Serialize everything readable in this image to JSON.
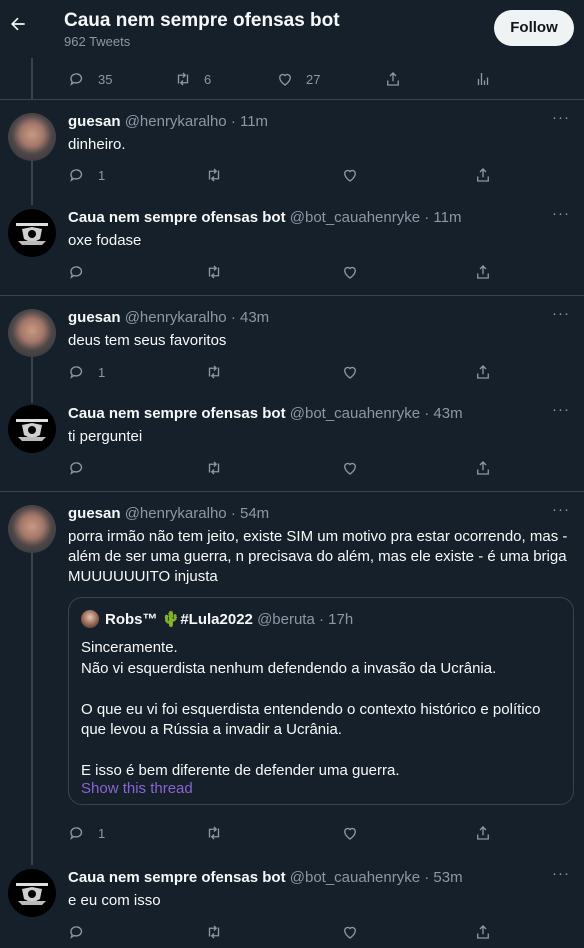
{
  "header": {
    "title": "Caua nem sempre ofensas bot",
    "tweet_count": "962 Tweets",
    "follow_label": "Follow"
  },
  "top_actions": {
    "replies": "35",
    "retweets": "6",
    "likes": "27"
  },
  "tweets": [
    {
      "name": "guesan",
      "handle": "@henrykaralho",
      "time": "· 11m",
      "text": "dinheiro.",
      "reply_count": "1"
    },
    {
      "name": "Caua nem sempre ofensas bot",
      "handle": "@bot_cauahenryke",
      "time": "· 11m",
      "text": "oxe fodase",
      "reply_count": ""
    },
    {
      "name": "guesan",
      "handle": "@henrykaralho",
      "time": "· 43m",
      "text": "deus tem seus favoritos",
      "reply_count": "1"
    },
    {
      "name": "Caua nem sempre ofensas bot",
      "handle": "@bot_cauahenryke",
      "time": "· 43m",
      "text": "ti perguntei",
      "reply_count": ""
    },
    {
      "name": "guesan",
      "handle": "@henrykaralho",
      "time": "· 54m",
      "text": "porra irmão não tem jeito, existe SIM um motivo pra estar ocorrendo, mas - além de ser uma guerra, n precisava do além, mas ele existe - é uma briga MUUUUUUITO injusta",
      "reply_count": "1"
    },
    {
      "name": "Caua nem sempre ofensas bot",
      "handle": "@bot_cauahenryke",
      "time": "· 53m",
      "text": "e eu com isso",
      "reply_count": ""
    }
  ],
  "quote": {
    "name": "Robs™ 🌵#Lula2022",
    "handle": "@beruta",
    "time": "· 17h",
    "line1": "Sinceramente.",
    "line2": "Não vi esquerdista nenhum defendendo a invasão da Ucrânia.",
    "line3": "O que eu vi foi esquerdista entendendo o contexto histórico e político",
    "line4": "que levou a Rússia a invadir a Ucrânia.",
    "line5": "E isso é bem diferente de defender uma guerra.",
    "show_thread": "Show this thread"
  },
  "more_label": "···",
  "colors": {
    "background": "#15202b",
    "border": "#38444d",
    "muted": "#8b98a5",
    "link": "#8a63d2"
  }
}
